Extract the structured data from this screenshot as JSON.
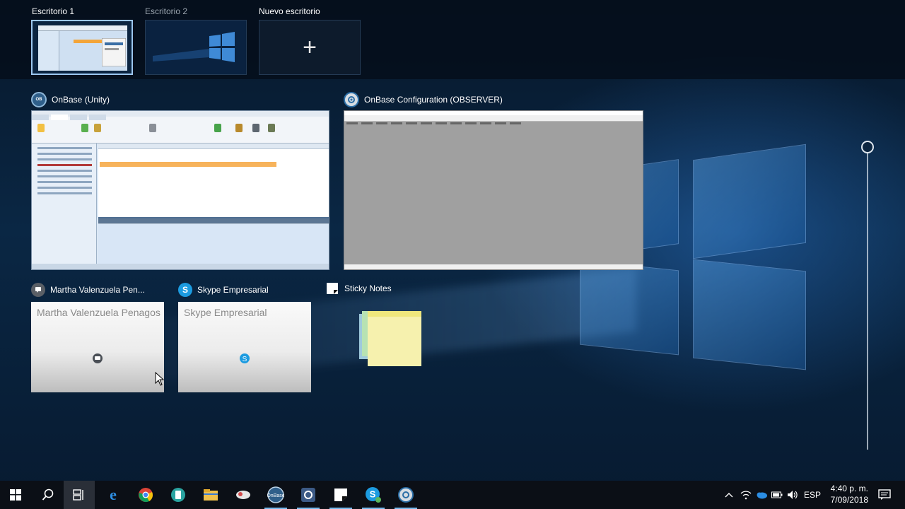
{
  "desktops": [
    {
      "label": "Escritorio 1",
      "active": true
    },
    {
      "label": "Escritorio 2",
      "active": false
    },
    {
      "label": "Nuevo escritorio",
      "icon": "plus-icon"
    }
  ],
  "windows": {
    "onbase_unity": {
      "title": "OnBase (Unity)",
      "icon": "onbase-icon"
    },
    "onbase_config": {
      "title": "OnBase Configuration (OBSERVER)",
      "icon": "gear-icon"
    },
    "martha": {
      "title": "Martha Valenzuela Pen...",
      "preview_text": "Martha Valenzuela Penagos",
      "icon": "chat-icon"
    },
    "skype": {
      "title": "Skype Empresarial",
      "preview_text": "Skype Empresarial",
      "icon": "skype-icon"
    },
    "sticky": {
      "title": "Sticky Notes",
      "icon": "sticky-notes-icon"
    }
  },
  "taskbar": {
    "pinned": [
      "windows-start-icon",
      "search-icon",
      "task-view-icon",
      "edge-icon",
      "chrome-icon",
      "app-icon",
      "file-explorer-icon",
      "cloud-app-icon",
      "onbase-icon",
      "config-tool-icon",
      "sticky-notes-icon",
      "skype-icon",
      "settings-gear-icon"
    ],
    "tray": {
      "language": "ESP",
      "time": "4:40 p. m.",
      "date": "7/09/2018"
    }
  },
  "colors": {
    "accent": "#76b9ed",
    "highlight_row": "#f7b35b"
  }
}
